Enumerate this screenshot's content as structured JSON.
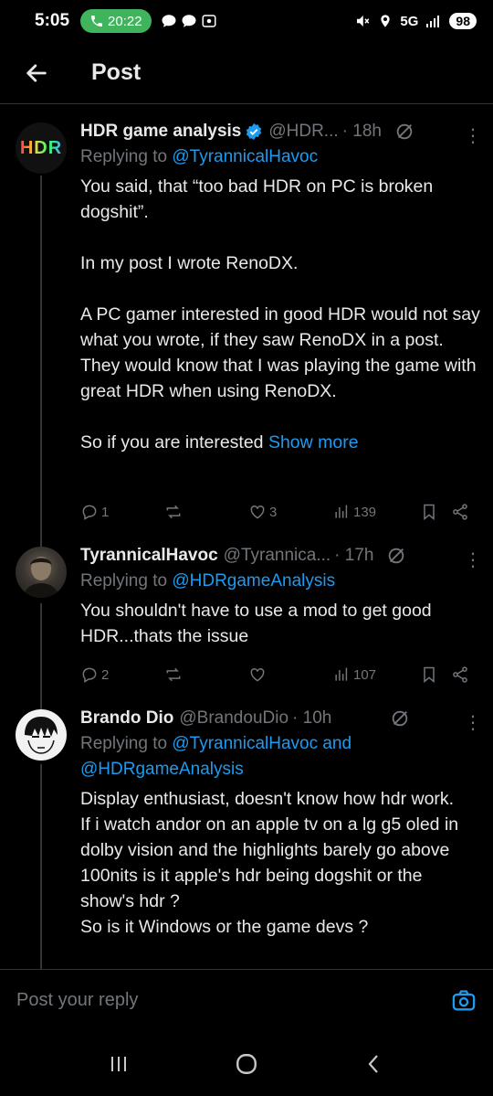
{
  "status_bar": {
    "time": "5:05",
    "call_duration": "20:22",
    "network": "5G",
    "battery": "98"
  },
  "header": {
    "title": "Post"
  },
  "posts": [
    {
      "name": "HDR game analysis",
      "verified": true,
      "handle": "@HDR...",
      "time": "· 18h",
      "replying_prefix": "Replying to ",
      "replying_to": "@TyrannicalHavoc",
      "text": "You said, that “too bad HDR on PC is broken dogshit”.\n\nIn my post I wrote RenoDX.\n\nA PC gamer interested in good HDR would not say what you wrote, if they saw RenoDX in a post. They would know that I was playing the game with great HDR when using RenoDX.\n\nSo if you are interested ",
      "show_more": "Show more",
      "replies": "1",
      "reposts": "",
      "likes": "3",
      "views": "139",
      "avatar_text": "HDR"
    },
    {
      "name": "TyrannicalHavoc",
      "handle": "@Tyrannica...",
      "time": "· 17h",
      "replying_prefix": "Replying to ",
      "replying_to": "@HDRgameAnalysis",
      "text": "You shouldn't have to use a mod to get good HDR...thats the issue",
      "replies": "2",
      "reposts": "",
      "likes": "",
      "views": "107"
    },
    {
      "name": "Brando Dio",
      "handle": "@BrandouDio",
      "time": "· 10h",
      "replying_prefix": "Replying to ",
      "replying_to": "@TyrannicalHavoc and @HDRgameAnalysis",
      "text": "Display enthusiast, doesn't know how hdr work.\nIf i watch andor on an apple tv on a lg g5 oled in dolby vision and the highlights barely go above 100nits is it apple's hdr being dogshit or the show's hdr ?\nSo is it Windows or the game devs ?"
    }
  ],
  "reply_bar": {
    "placeholder": "Post your reply"
  },
  "colors": {
    "background": "#000000",
    "text": "#e7e9ea",
    "muted": "#71767b",
    "link": "#1d9bf0",
    "verified": "#1d9bf0",
    "call_pill": "#3fb45c"
  }
}
